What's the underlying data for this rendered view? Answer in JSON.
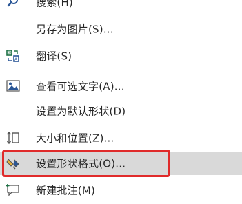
{
  "menu": {
    "items": [
      {
        "label": "搜索(H)",
        "icon": "search-icon"
      },
      {
        "label": "另存为图片(S)...",
        "icon": null
      },
      {
        "label": "翻译(S)",
        "icon": "translate-icon"
      },
      {
        "label": "查看可选文字(A)...",
        "icon": "alt-text-icon"
      },
      {
        "label": "设置为默认形状(D)",
        "icon": null
      },
      {
        "label": "大小和位置(Z)...",
        "icon": "size-position-icon"
      },
      {
        "label": "设置形状格式(O)...",
        "icon": "format-shape-icon"
      },
      {
        "label": "新建批注(M)",
        "icon": "new-comment-icon"
      }
    ]
  },
  "colors": {
    "highlight_border": "#e02b2b",
    "highlight_bg": "#d9d9d9"
  }
}
